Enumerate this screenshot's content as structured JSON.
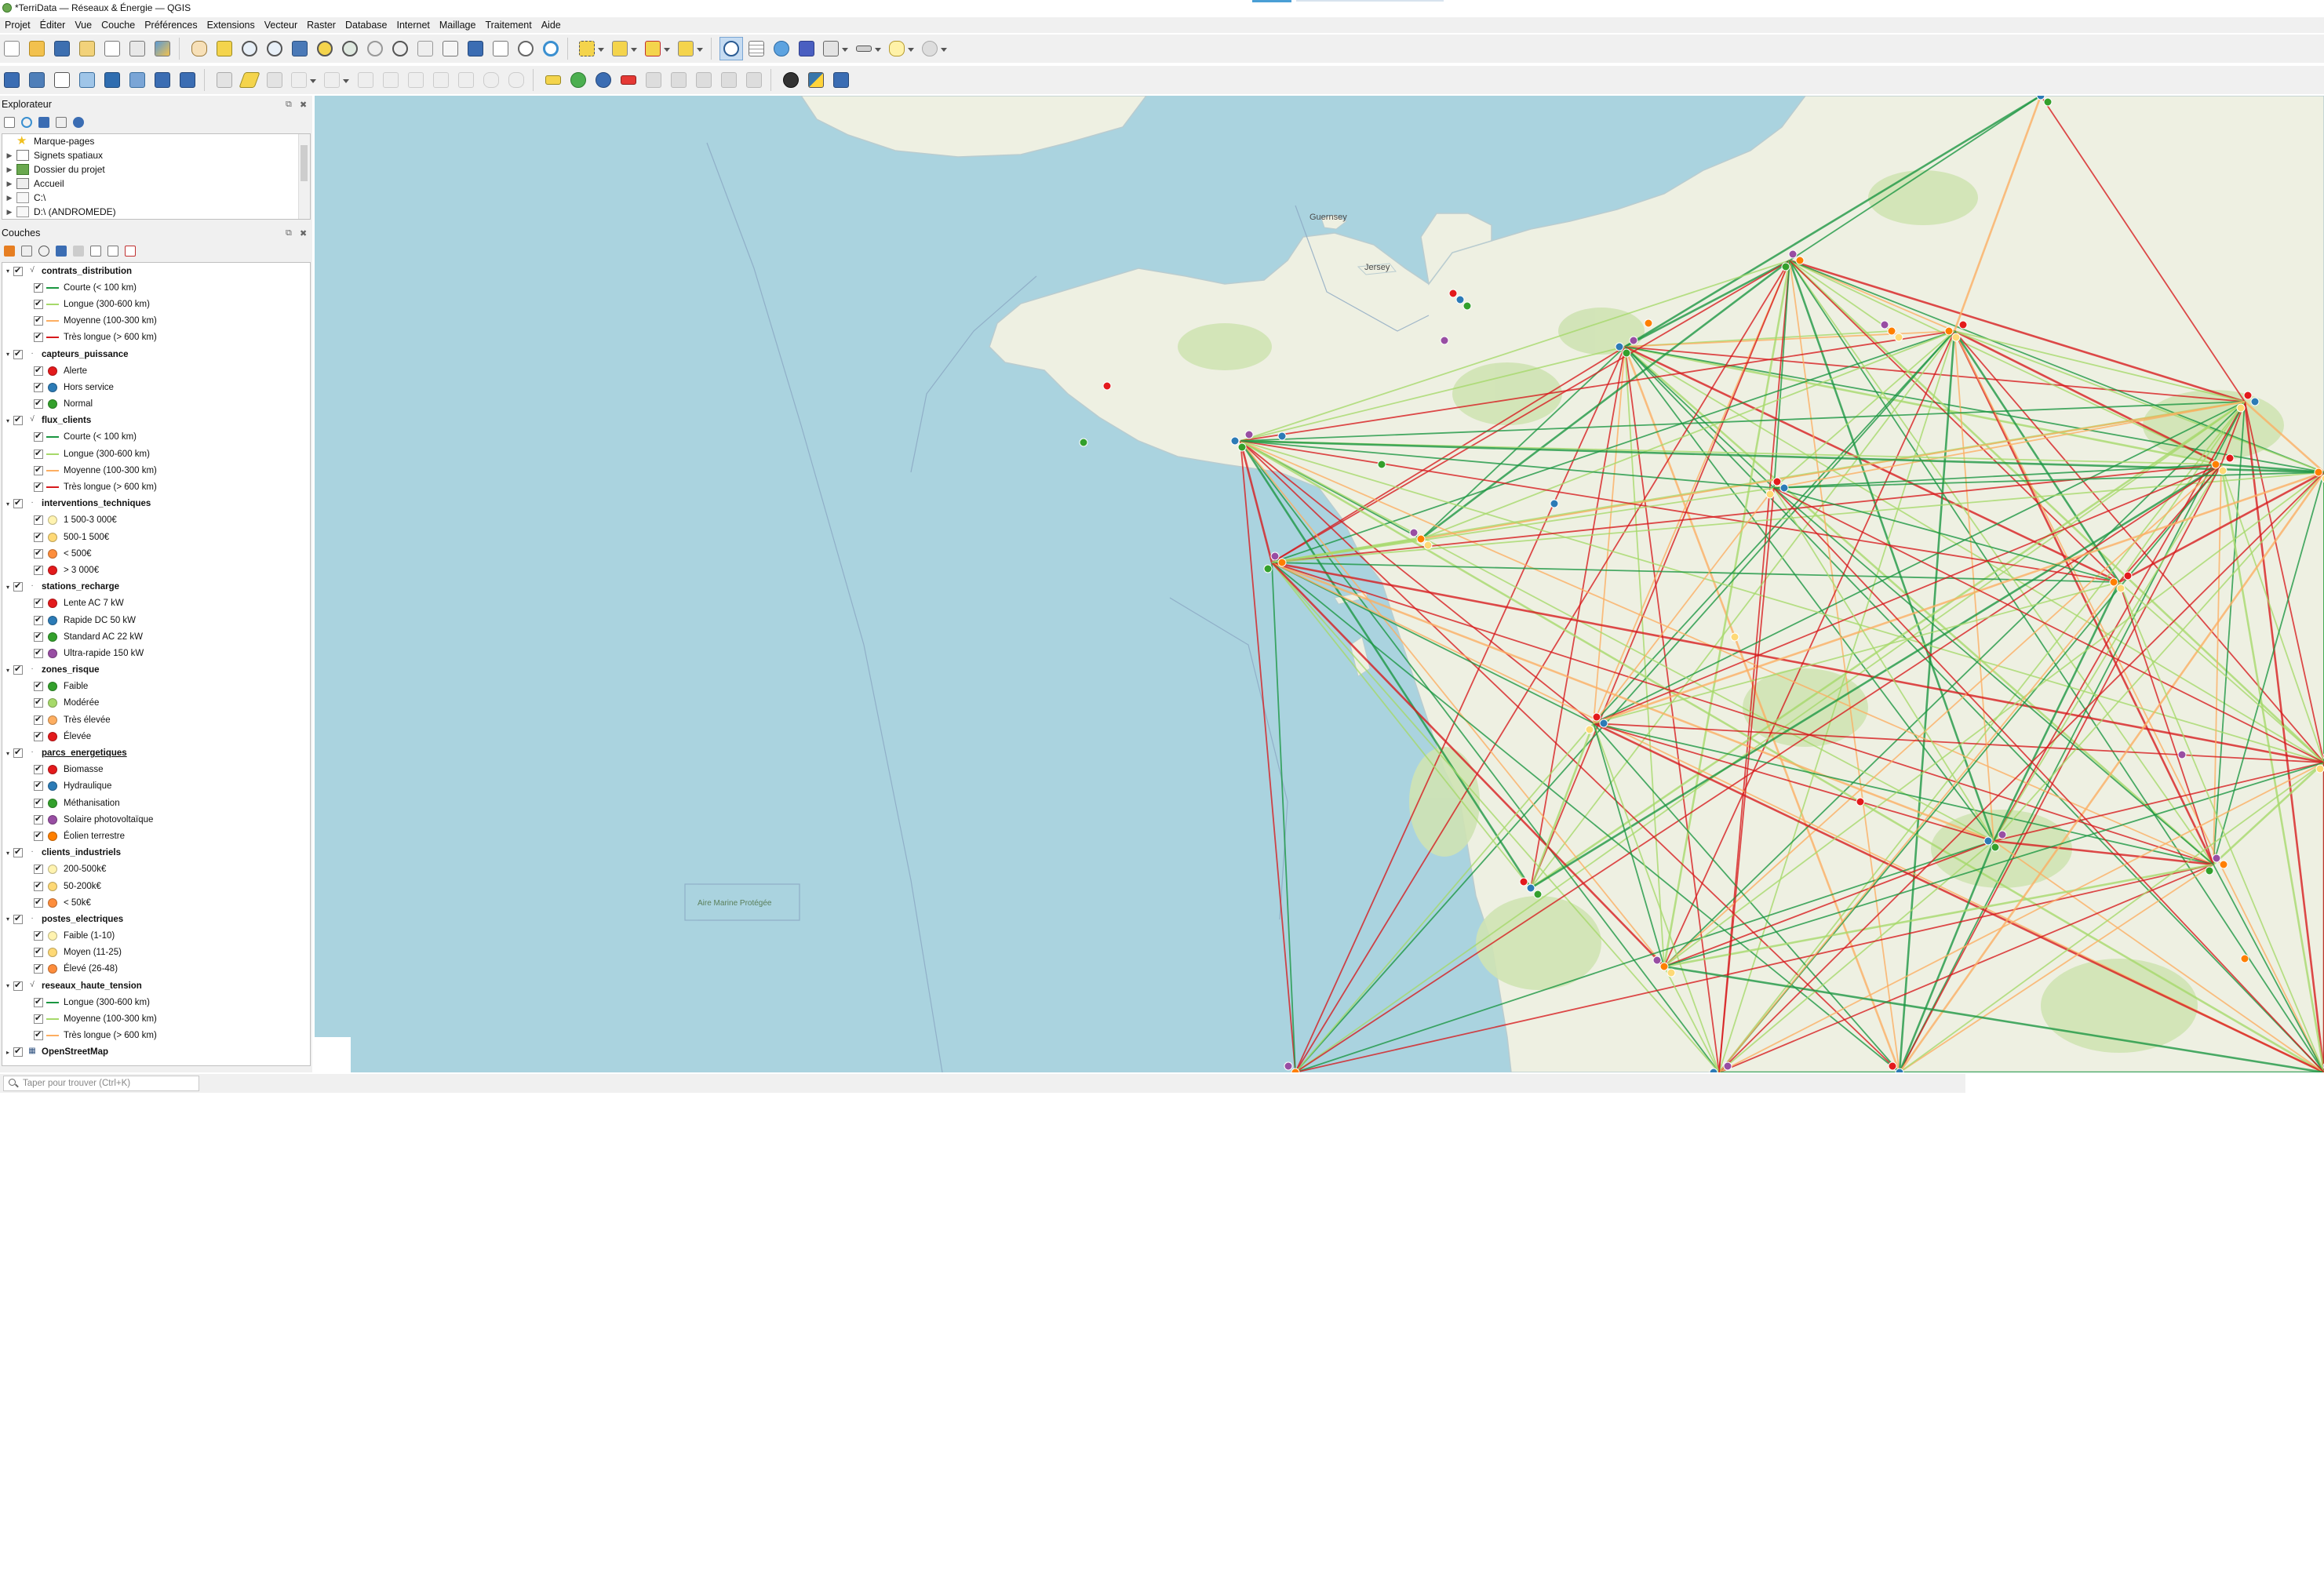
{
  "window": {
    "title": "*TerriData — Réseaux & Énergie — QGIS"
  },
  "menubar": [
    {
      "label": "Projet"
    },
    {
      "label": "Éditer"
    },
    {
      "label": "Vue"
    },
    {
      "label": "Couche"
    },
    {
      "label": "Préférences"
    },
    {
      "label": "Extensions"
    },
    {
      "label": "Vecteur"
    },
    {
      "label": "Raster"
    },
    {
      "label": "Database"
    },
    {
      "label": "Internet"
    },
    {
      "label": "Maillage"
    },
    {
      "label": "Traitement"
    },
    {
      "label": "Aide"
    }
  ],
  "browser_panel": {
    "title": "Explorateur",
    "items": [
      {
        "label": "Marque-pages",
        "icon": "star-icon"
      },
      {
        "label": "Signets spatiaux",
        "icon": "spatial-bookmark-icon"
      },
      {
        "label": "Dossier du projet",
        "icon": "project-folder-icon"
      },
      {
        "label": "Accueil",
        "icon": "home-folder-icon"
      },
      {
        "label": "C:\\",
        "icon": "drive-icon"
      },
      {
        "label": "D:\\ (ANDROMEDE)",
        "icon": "drive-icon"
      }
    ]
  },
  "layers_panel": {
    "title": "Couches",
    "layers": [
      {
        "name": "contrats_distribution",
        "type": "line",
        "legend": [
          {
            "label": "Courte (< 100 km)",
            "color": "#1a9641",
            "kind": "line"
          },
          {
            "label": "Longue (300-600 km)",
            "color": "#a6d96a",
            "kind": "line"
          },
          {
            "label": "Moyenne (100-300 km)",
            "color": "#fdae61",
            "kind": "line"
          },
          {
            "label": "Très longue (> 600 km)",
            "color": "#d7191c",
            "kind": "line"
          }
        ]
      },
      {
        "name": "capteurs_puissance",
        "type": "point",
        "legend": [
          {
            "label": "Alerte",
            "color": "#e31a1c",
            "kind": "dot"
          },
          {
            "label": "Hors service",
            "color": "#2c7bb6",
            "kind": "dot"
          },
          {
            "label": "Normal",
            "color": "#33a02c",
            "kind": "dot"
          }
        ]
      },
      {
        "name": "flux_clients",
        "type": "line",
        "legend": [
          {
            "label": "Courte (< 100 km)",
            "color": "#1a9641",
            "kind": "line"
          },
          {
            "label": "Longue (300-600 km)",
            "color": "#a6d96a",
            "kind": "line"
          },
          {
            "label": "Moyenne (100-300 km)",
            "color": "#fdae61",
            "kind": "line"
          },
          {
            "label": "Très longue (> 600 km)",
            "color": "#d7191c",
            "kind": "line"
          }
        ]
      },
      {
        "name": "interventions_techniques",
        "type": "point",
        "legend": [
          {
            "label": "1 500-3 000€",
            "color": "#fff3b0",
            "kind": "dot"
          },
          {
            "label": "500-1 500€",
            "color": "#fed976",
            "kind": "dot"
          },
          {
            "label": "< 500€",
            "color": "#fd8d3c",
            "kind": "dot"
          },
          {
            "label": "> 3 000€",
            "color": "#e31a1c",
            "kind": "dot"
          }
        ]
      },
      {
        "name": "stations_recharge",
        "type": "point",
        "legend": [
          {
            "label": "Lente AC 7 kW",
            "color": "#e31a1c",
            "kind": "dot"
          },
          {
            "label": "Rapide DC 50 kW",
            "color": "#2c7bb6",
            "kind": "dot"
          },
          {
            "label": "Standard AC 22 kW",
            "color": "#33a02c",
            "kind": "dot"
          },
          {
            "label": "Ultra-rapide 150 kW",
            "color": "#984ea3",
            "kind": "dot"
          }
        ]
      },
      {
        "name": "zones_risque",
        "type": "point",
        "legend": [
          {
            "label": "Faible",
            "color": "#33a02c",
            "kind": "dot"
          },
          {
            "label": "Modérée",
            "color": "#a6d96a",
            "kind": "dot"
          },
          {
            "label": "Très élevée",
            "color": "#fdae61",
            "kind": "dot"
          },
          {
            "label": "Élevée",
            "color": "#e31a1c",
            "kind": "dot"
          }
        ]
      },
      {
        "name": "parcs_energetiques",
        "type": "point",
        "underlined": true,
        "legend": [
          {
            "label": "Biomasse",
            "color": "#e31a1c",
            "kind": "dot"
          },
          {
            "label": "Hydraulique",
            "color": "#2c7bb6",
            "kind": "dot"
          },
          {
            "label": "Méthanisation",
            "color": "#33a02c",
            "kind": "dot"
          },
          {
            "label": "Solaire photovoltaïque",
            "color": "#984ea3",
            "kind": "dot"
          },
          {
            "label": "Éolien terrestre",
            "color": "#ff7f00",
            "kind": "dot"
          }
        ]
      },
      {
        "name": "clients_industriels",
        "type": "point",
        "legend": [
          {
            "label": "200-500k€",
            "color": "#fff3b0",
            "kind": "dot"
          },
          {
            "label": "50-200k€",
            "color": "#fed976",
            "kind": "dot"
          },
          {
            "label": "< 50k€",
            "color": "#fd8d3c",
            "kind": "dot"
          }
        ]
      },
      {
        "name": "postes_electriques",
        "type": "point",
        "legend": [
          {
            "label": "Faible (1-10)",
            "color": "#fff3b0",
            "kind": "dot"
          },
          {
            "label": "Moyen (11-25)",
            "color": "#fed976",
            "kind": "dot"
          },
          {
            "label": "Élevé (26-48)",
            "color": "#fd8d3c",
            "kind": "dot"
          }
        ]
      },
      {
        "name": "reseaux_haute_tension",
        "type": "line",
        "legend": [
          {
            "label": "Longue (300-600 km)",
            "color": "#1a9641",
            "kind": "line"
          },
          {
            "label": "Moyenne (100-300 km)",
            "color": "#a6d96a",
            "kind": "line"
          },
          {
            "label": "Très longue (> 600 km)",
            "color": "#fdae61",
            "kind": "line"
          }
        ]
      },
      {
        "name": "OpenStreetMap",
        "type": "raster",
        "legend": []
      }
    ]
  },
  "map": {
    "labels": {
      "guernsey": "Guernsey",
      "jersey": "Jersey",
      "marine_area": "Aire Marine Protégée"
    },
    "colors": {
      "sea": "#aad3df",
      "land": "#eef0e2",
      "green": "#cfe3b4",
      "forest": "#b9d6a0"
    }
  },
  "statusbar": {
    "locator_placeholder": "Taper pour trouver (Ctrl+K)"
  }
}
